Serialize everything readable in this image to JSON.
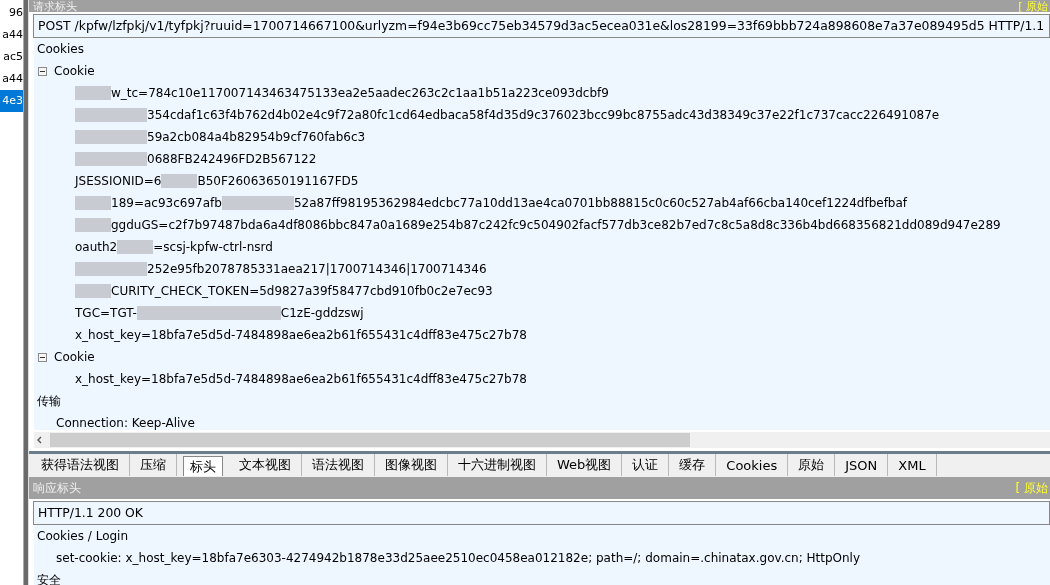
{
  "session_list": [
    {
      "text": "96",
      "selected": false
    },
    {
      "text": "a44",
      "selected": false
    },
    {
      "text": "ac5",
      "selected": false
    },
    {
      "text": "a44",
      "selected": false
    },
    {
      "text": "4e3",
      "selected": true
    }
  ],
  "request": {
    "header_title": "请求标头",
    "raw_link": "[ 原始",
    "request_line": "POST /kpfw/lzfpkj/v1/tyfpkj?ruuid=1700714667100&urlyzm=f94e3b69cc75eb34579d3ac5ecea031e&los28199=33f69bbb724a898608e7a37e089495d5 HTTP/1.1",
    "groups": [
      {
        "title": "Cookies",
        "nodes": [
          {
            "title": "Cookie",
            "expanded": true,
            "lines": [
              [
                {
                  "kind": "redacted"
                },
                {
                  "kind": "text",
                  "text": "w_tc=784c10e117007143463475133ea2e5aadec263c2c1aa1b51a223ce093dcbf9"
                }
              ],
              [
                {
                  "kind": "redacted"
                },
                {
                  "kind": "redacted"
                },
                {
                  "kind": "text",
                  "text": "354cdaf1c63f4b762d4b02e4c9f72a80fc1cd64edbaca58f4d35d9c376023bcc99bc8755adc43d38349c37e22f1c737cacc226491087e"
                }
              ],
              [
                {
                  "kind": "redacted"
                },
                {
                  "kind": "redacted"
                },
                {
                  "kind": "text",
                  "text": "59a2cb084a4b82954b9cf760fab6c3"
                }
              ],
              [
                {
                  "kind": "redacted"
                },
                {
                  "kind": "redacted"
                },
                {
                  "kind": "text",
                  "text": "0688FB242496FD2B567122"
                }
              ],
              [
                {
                  "kind": "text",
                  "text": "JSESSIONID=6"
                },
                {
                  "kind": "redacted"
                },
                {
                  "kind": "text",
                  "text": "B50F26063650191167FD5"
                }
              ],
              [
                {
                  "kind": "redacted"
                },
                {
                  "kind": "text",
                  "text": "189=ac93c697afb"
                },
                {
                  "kind": "redacted"
                },
                {
                  "kind": "redacted"
                },
                {
                  "kind": "text",
                  "text": "52a87ff98195362984edcbc77a10dd13ae4ca0701bb88815c0c60c527ab4af66cba140cef1224dfbefbaf"
                }
              ],
              [
                {
                  "kind": "redacted"
                },
                {
                  "kind": "text",
                  "text": "ggduGS=c2f7b97487bda6a4df8086bbc847a0a1689e254b87c242fc9c504902facf577db3ce82b7ed7c8c5a8d8c336b4bd668356821dd089d947e289"
                }
              ],
              [
                {
                  "kind": "text",
                  "text": "oauth2"
                },
                {
                  "kind": "redacted"
                },
                {
                  "kind": "text",
                  "text": "=scsj-kpfw-ctrl-nsrd"
                }
              ],
              [
                {
                  "kind": "redacted"
                },
                {
                  "kind": "redacted"
                },
                {
                  "kind": "text",
                  "text": "252e95fb2078785331aea217|1700714346|1700714346"
                }
              ],
              [
                {
                  "kind": "redacted"
                },
                {
                  "kind": "text",
                  "text": "CURITY_CHECK_TOKEN=5d9827a39f58477cbd910fb0c2e7ec93"
                }
              ],
              [
                {
                  "kind": "text",
                  "text": "TGC=TGT-"
                },
                {
                  "kind": "redacted"
                },
                {
                  "kind": "redacted"
                },
                {
                  "kind": "redacted"
                },
                {
                  "kind": "redacted"
                },
                {
                  "kind": "text",
                  "text": "C1zE-gddzswj"
                }
              ],
              [
                {
                  "kind": "text",
                  "text": "x_host_key=18bfa7e5d5d-7484898ae6ea2b61f655431c4dff83e475c27b78"
                }
              ]
            ]
          },
          {
            "title": "Cookie",
            "expanded": true,
            "lines": [
              [
                {
                  "kind": "text",
                  "text": "x_host_key=18bfa7e5d5d-7484898ae6ea2b61f655431c4dff83e475c27b78"
                }
              ]
            ]
          }
        ]
      },
      {
        "title": "传输",
        "entries": [
          "Connection: Keep-Alive"
        ]
      }
    ]
  },
  "tabs": [
    {
      "label": "获得语法视图",
      "selected": false
    },
    {
      "label": "压缩",
      "selected": false
    },
    {
      "label": "标头",
      "selected": true
    },
    {
      "label": "文本视图",
      "selected": false
    },
    {
      "label": "语法视图",
      "selected": false
    },
    {
      "label": "图像视图",
      "selected": false
    },
    {
      "label": "十六进制视图",
      "selected": false
    },
    {
      "label": "Web视图",
      "selected": false
    },
    {
      "label": "认证",
      "selected": false
    },
    {
      "label": "缓存",
      "selected": false
    },
    {
      "label": "Cookies",
      "selected": false
    },
    {
      "label": "原始",
      "selected": false
    },
    {
      "label": "JSON",
      "selected": false
    },
    {
      "label": "XML",
      "selected": false
    }
  ],
  "response": {
    "header_title": "响应标头",
    "raw_link": "[ 原始",
    "status_line": "HTTP/1.1 200 OK",
    "groups": [
      {
        "title": "Cookies / Login",
        "entries": [
          "set-cookie: x_host_key=18bfa7e6303-4274942b1878e33d25aee2510ec0458ea012182e; path=/; domain=.chinatax.gov.cn; HttpOnly"
        ]
      },
      {
        "title": "安全"
      }
    ]
  }
}
